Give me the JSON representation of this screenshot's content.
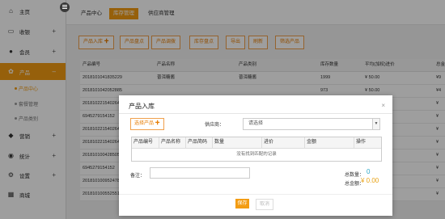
{
  "sidebar": {
    "items": [
      {
        "label": "主页",
        "icon": "home-icon",
        "plus": ""
      },
      {
        "label": "收银",
        "icon": "monitor-icon",
        "plus": "+"
      },
      {
        "label": "会员",
        "icon": "user-icon",
        "plus": "+"
      },
      {
        "label": "产品",
        "icon": "gear-icon",
        "plus": "–"
      },
      {
        "label": "营销",
        "icon": "tag-icon",
        "plus": "+"
      },
      {
        "label": "统计",
        "icon": "globe-icon",
        "plus": "+"
      },
      {
        "label": "设置",
        "icon": "settings-icon",
        "plus": "+"
      },
      {
        "label": "商城",
        "icon": "store-icon",
        "plus": ""
      }
    ],
    "subitems": [
      "产品中心",
      "套餐管理",
      "产品类别"
    ]
  },
  "tabs": [
    "产品中心",
    "库存管理",
    "供应商管理"
  ],
  "toolbar": [
    "产品入库 ✚",
    "产品盘点",
    "产品调拨",
    "库存盘点",
    "导出",
    "刷新",
    "筛选产品"
  ],
  "grid": {
    "headers": [
      "产品编号",
      "产品名称",
      "产品类别",
      "库存数量",
      "平均(加权)进价",
      "总金"
    ],
    "rows": [
      [
        "2018101041835229",
        "普洱糖酱",
        "普洱糖酱",
        "1999",
        "¥ 50.00",
        "¥9"
      ],
      [
        "2018101042052885",
        "",
        "",
        "973",
        "¥ 50.00",
        "¥4"
      ],
      [
        "2018102215402648",
        "",
        "",
        "",
        "",
        "¥"
      ],
      [
        "6945279154152",
        "",
        "",
        "",
        "",
        "¥"
      ],
      [
        "2018102215402648",
        "",
        "",
        "",
        "",
        "¥"
      ],
      [
        "2018102215402648",
        "",
        "",
        "",
        "",
        "¥"
      ],
      [
        "2018101004285057",
        "",
        "",
        "",
        "",
        "¥"
      ],
      [
        "6945279154152",
        "",
        "",
        "",
        "",
        "¥"
      ],
      [
        "2018101009524785",
        "",
        "",
        "",
        "",
        "¥"
      ],
      [
        "2018101005525515",
        "",
        "",
        "",
        "",
        "¥"
      ]
    ]
  },
  "modal": {
    "title": "产品入库",
    "close": "×",
    "select_product": "选择产品 ✚",
    "supplier_label": "供应商：",
    "supplier_value": "请选择",
    "table_headers": [
      "产品编号",
      "产品名称",
      "产品简码",
      "数量",
      "进价",
      "金额",
      "操作"
    ],
    "empty_text": "没有找到匹配的记录",
    "remark_label": "备注：",
    "total_qty_label": "总数量：",
    "total_qty": "0",
    "total_amount_label": "总金额：",
    "total_amount": "¥ 0.00",
    "save": "保存",
    "cancel": "取消"
  },
  "colors": {
    "accent": "#f39c12",
    "price": "#d9534f",
    "total": "#2aa7c9"
  }
}
